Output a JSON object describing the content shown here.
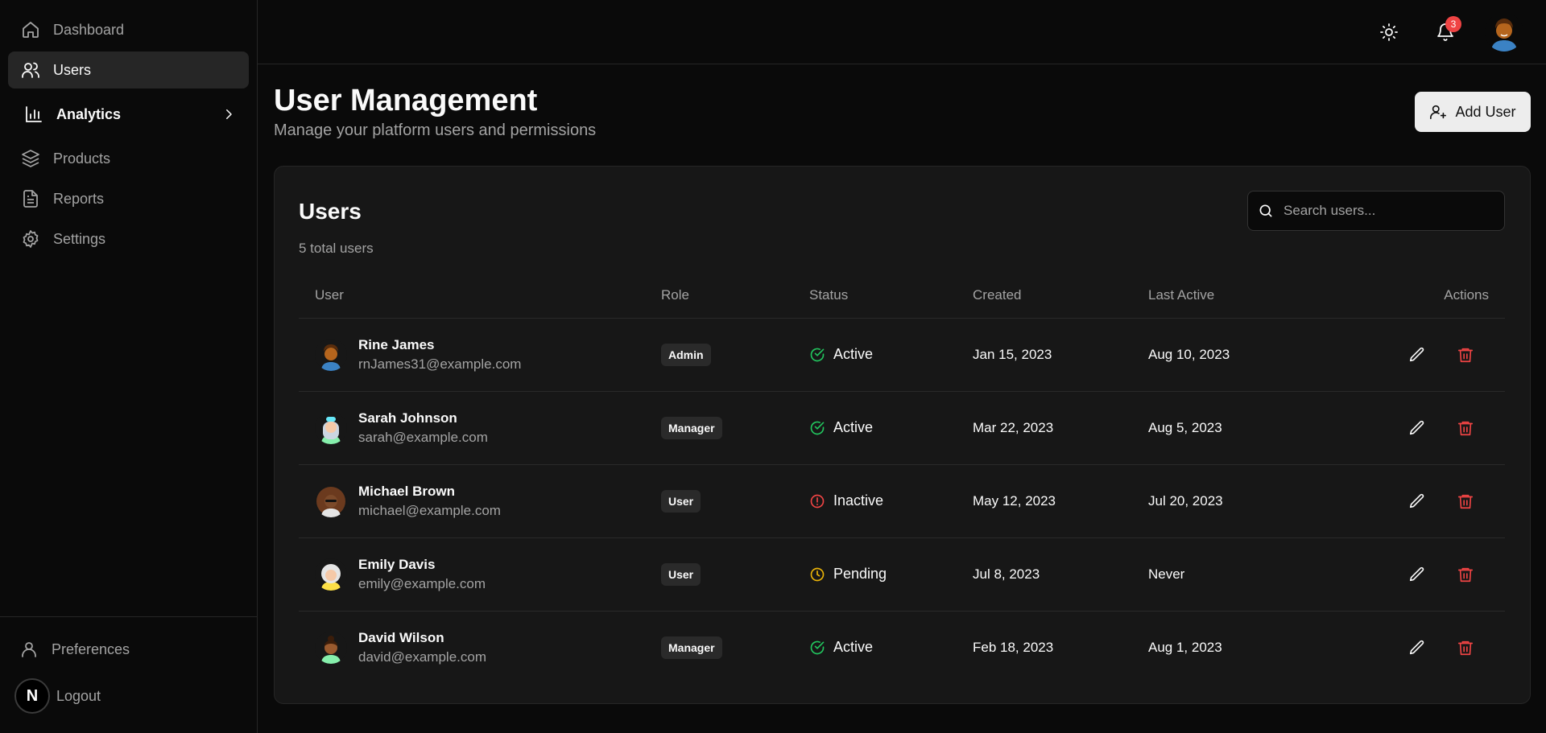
{
  "sidebar": {
    "items": [
      {
        "label": "Dashboard",
        "icon": "home-icon"
      },
      {
        "label": "Users",
        "icon": "users-icon"
      },
      {
        "label": "Analytics",
        "icon": "bar-chart-icon"
      },
      {
        "label": "Products",
        "icon": "layers-icon"
      },
      {
        "label": "Reports",
        "icon": "file-text-icon"
      },
      {
        "label": "Settings",
        "icon": "gear-icon"
      }
    ],
    "preferences": "Preferences",
    "logout": "Logout",
    "logo_letter": "N"
  },
  "topbar": {
    "notification_count": "3"
  },
  "header": {
    "title": "User Management",
    "subtitle": "Manage your platform users and permissions",
    "add_user_label": "Add User"
  },
  "users_card": {
    "title": "Users",
    "count_label": "5 total users",
    "search_placeholder": "Search users...",
    "columns": [
      "User",
      "Role",
      "Status",
      "Created",
      "Last Active",
      "Actions"
    ],
    "rows": [
      {
        "name": "Rine James",
        "email": "rnJames31@example.com",
        "role": "Admin",
        "status": "Active",
        "created": "Jan 15, 2023",
        "last_active": "Aug 10, 2023"
      },
      {
        "name": "Sarah Johnson",
        "email": "sarah@example.com",
        "role": "Manager",
        "status": "Active",
        "created": "Mar 22, 2023",
        "last_active": "Aug 5, 2023"
      },
      {
        "name": "Michael Brown",
        "email": "michael@example.com",
        "role": "User",
        "status": "Inactive",
        "created": "May 12, 2023",
        "last_active": "Jul 20, 2023"
      },
      {
        "name": "Emily Davis",
        "email": "emily@example.com",
        "role": "User",
        "status": "Pending",
        "created": "Jul 8, 2023",
        "last_active": "Never"
      },
      {
        "name": "David Wilson",
        "email": "david@example.com",
        "role": "Manager",
        "status": "Active",
        "created": "Feb 18, 2023",
        "last_active": "Aug 1, 2023"
      }
    ]
  },
  "colors": {
    "active": "#22c55e",
    "inactive": "#ef4444",
    "pending": "#eab308",
    "delete": "#ef4444"
  }
}
